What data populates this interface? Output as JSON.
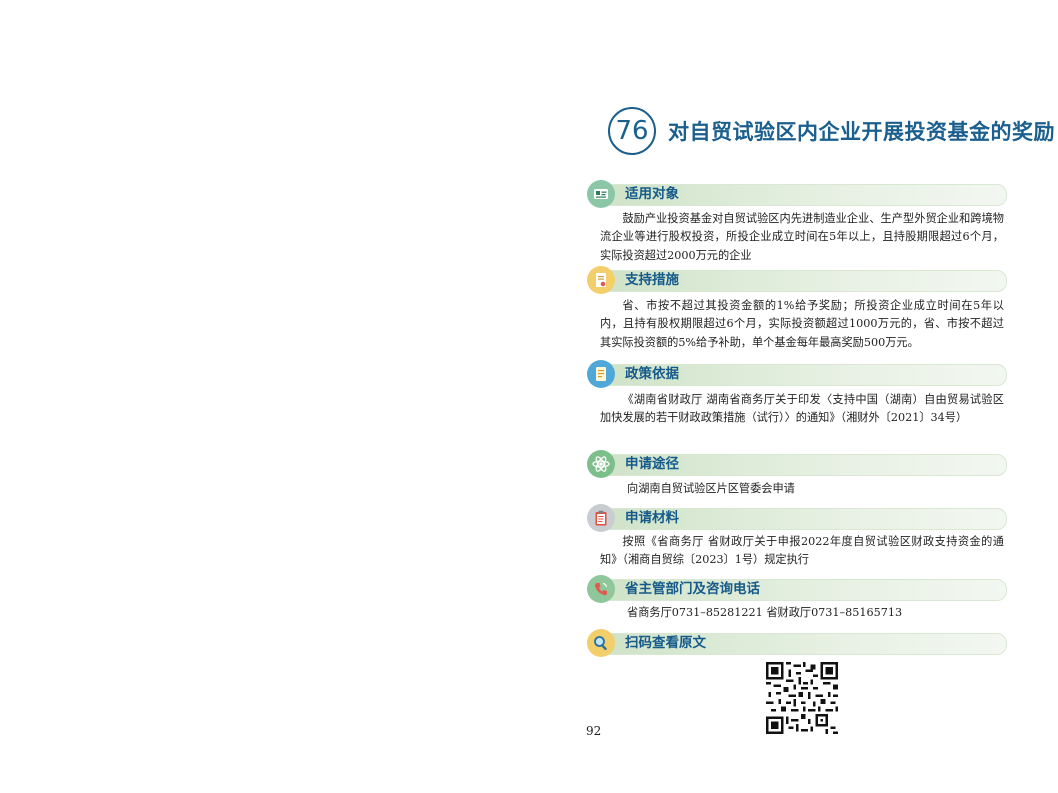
{
  "title": {
    "number": "76",
    "text": "对自贸试验区内企业开展投资基金的奖励"
  },
  "sections": [
    {
      "heading": "适用对象",
      "icon": "id-card-icon",
      "icon_color": "#8bc7a6",
      "body": "鼓励产业投资基金对自贸试验区内先进制造业企业、生产型外贸企业和跨境物流企业等进行股权投资，所投企业成立时间在5年以上，且持股期限超过6个月，实际投资超过2000万元的企业"
    },
    {
      "heading": "支持措施",
      "icon": "document-seal-icon",
      "icon_color": "#f2cf6a",
      "body": "省、市按不超过其投资金额的1%给予奖励；所投资企业成立时间在5年以内，且持有股权期限超过6个月，实际投资额超过1000万元的，省、市按不超过其实际投资额的5%给予补助，单个基金每年最高奖励500万元。"
    },
    {
      "heading": "政策依据",
      "icon": "policy-document-icon",
      "icon_color": "#4fa8d8",
      "body": "《湖南省财政厅 湖南省商务厅关于印发〈支持中国（湖南）自由贸易试验区加快发展的若干财政政策措施（试行）〉的通知》（湘财外〔2021〕34号）"
    },
    {
      "heading": "申请途径",
      "icon": "atom-icon",
      "icon_color": "#7dbf8a",
      "body": "向湖南自贸试验区片区管委会申请"
    },
    {
      "heading": "申请材料",
      "icon": "clipboard-icon",
      "icon_color": "#c9ccd1",
      "body": "按照《省商务厅 省财政厅关于申报2022年度自贸试验区财政支持资金的通知》（湘商自贸综〔2023〕1号）规定执行"
    },
    {
      "heading": "省主管部门及咨询电话",
      "icon": "phone-icon",
      "icon_color": "#8fc79a",
      "body": "省商务厅0731–85281221  省财政厅0731–85165713"
    },
    {
      "heading": "扫码查看原文",
      "icon": "magnifier-icon",
      "icon_color": "#f2cf6a",
      "body": ""
    }
  ],
  "page_number": "92"
}
